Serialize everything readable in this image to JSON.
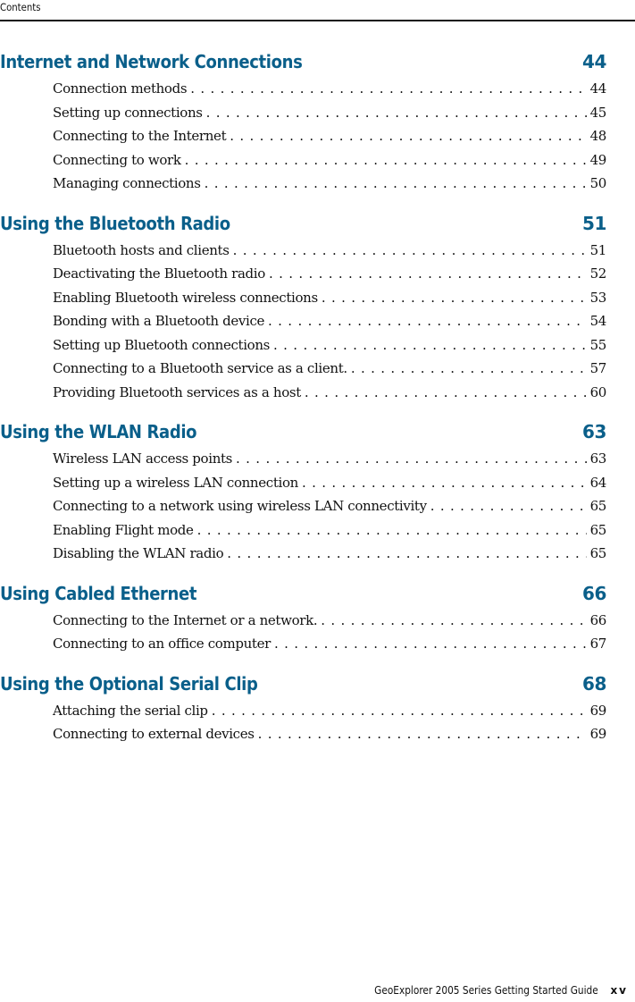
{
  "header": {
    "running_title": "Contents"
  },
  "sections": [
    {
      "title": "Internet and Network Connections",
      "page": "44",
      "entries": [
        {
          "title": "Connection methods",
          "page": "44"
        },
        {
          "title": "Setting up connections",
          "page": "45"
        },
        {
          "title": "Connecting to the Internet",
          "page": "48"
        },
        {
          "title": "Connecting to work",
          "page": "49"
        },
        {
          "title": "Managing connections",
          "page": "50"
        }
      ]
    },
    {
      "title": "Using the Bluetooth Radio",
      "page": "51",
      "entries": [
        {
          "title": "Bluetooth hosts and clients",
          "page": "51"
        },
        {
          "title": "Deactivating the Bluetooth radio",
          "page": "52"
        },
        {
          "title": "Enabling Bluetooth wireless connections",
          "page": "53"
        },
        {
          "title": "Bonding with a Bluetooth device",
          "page": "54"
        },
        {
          "title": "Setting up Bluetooth connections",
          "page": "55"
        },
        {
          "title": "Connecting to a Bluetooth service as a client.",
          "page": "57"
        },
        {
          "title": "Providing Bluetooth services as a host",
          "page": "60"
        }
      ]
    },
    {
      "title": "Using the WLAN Radio",
      "page": "63",
      "entries": [
        {
          "title": "Wireless LAN access points",
          "page": "63"
        },
        {
          "title": "Setting up a wireless LAN connection",
          "page": "64"
        },
        {
          "title": "Connecting to a network using wireless LAN connectivity",
          "page": "65"
        },
        {
          "title": "Enabling Flight mode",
          "page": "65"
        },
        {
          "title": "Disabling the WLAN radio",
          "page": "65"
        }
      ]
    },
    {
      "title": "Using Cabled Ethernet",
      "page": "66",
      "entries": [
        {
          "title": "Connecting to the Internet or a network.",
          "page": "66"
        },
        {
          "title": "Connecting to an office computer",
          "page": "67"
        }
      ]
    },
    {
      "title": "Using the Optional Serial Clip",
      "page": "68",
      "entries": [
        {
          "title": "Attaching the serial clip",
          "page": "69"
        },
        {
          "title": "Connecting to external devices",
          "page": "69"
        }
      ]
    }
  ],
  "footer": {
    "book_title": "GeoExplorer 2005 Series Getting Started Guide",
    "page_number": "xv"
  },
  "colors": {
    "section_heading": "#0a5f8a",
    "text": "#111111"
  }
}
